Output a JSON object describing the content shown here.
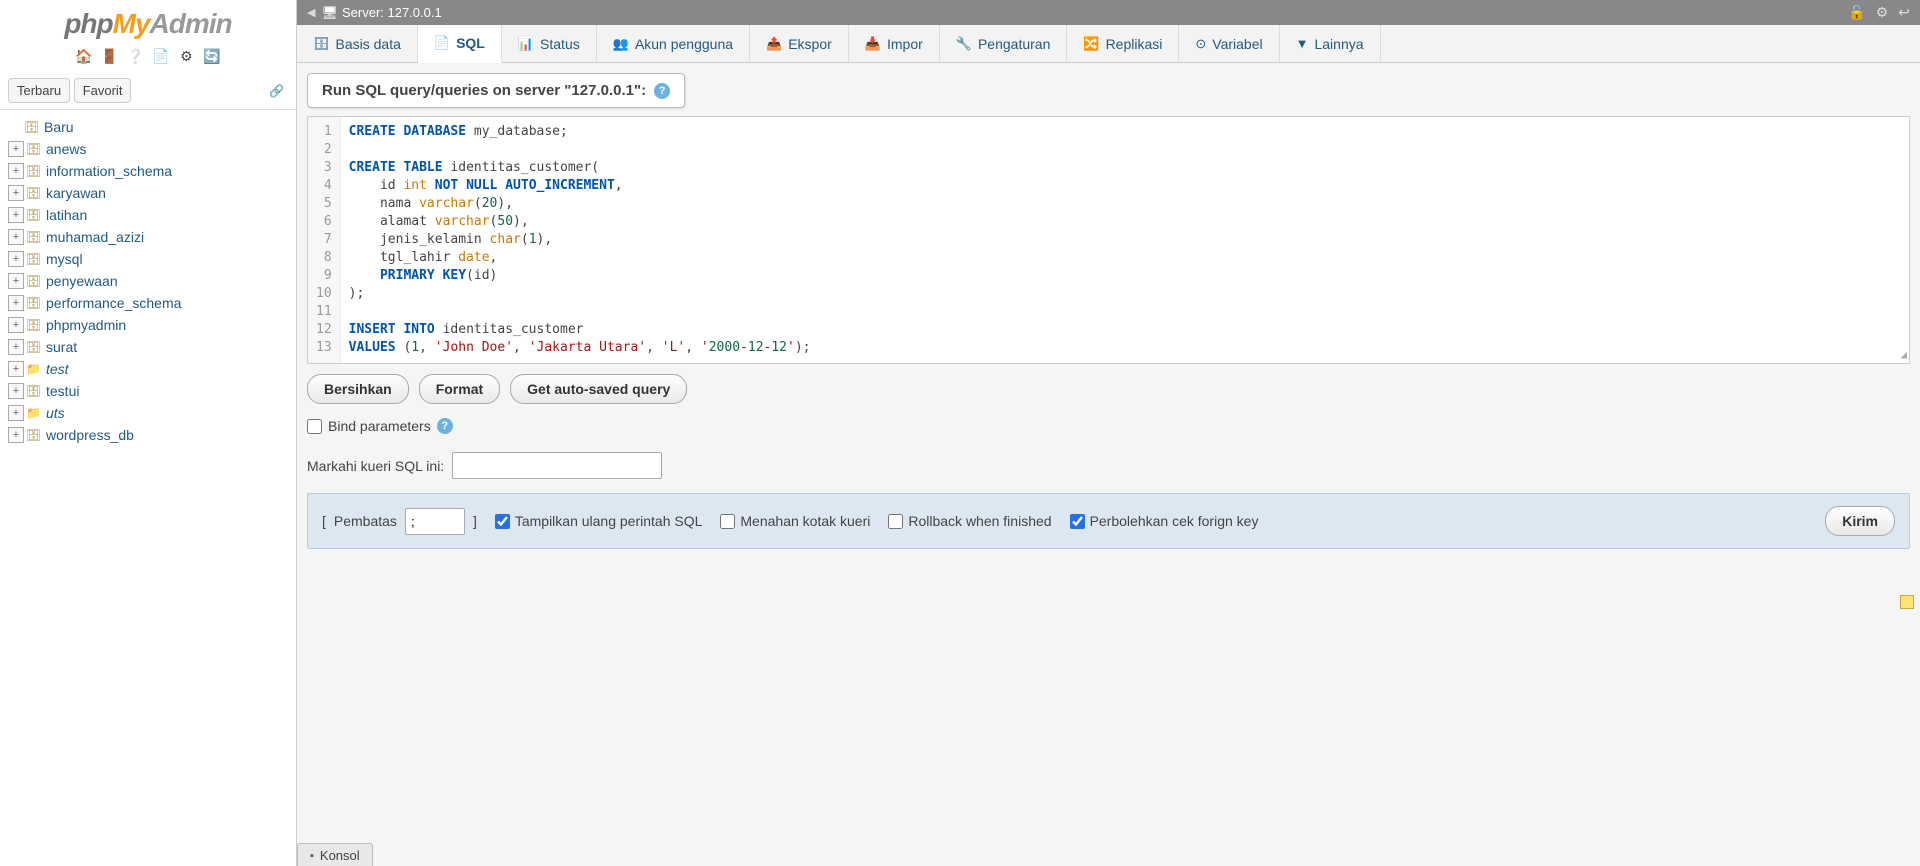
{
  "logo": {
    "p1": "php",
    "p2": "My",
    "p3": "Admin"
  },
  "recent_tabs": {
    "terbaru": "Terbaru",
    "favorit": "Favorit"
  },
  "tree": {
    "baru": "Baru",
    "items": [
      {
        "label": "anews",
        "italic": false,
        "folder": false
      },
      {
        "label": "information_schema",
        "italic": false,
        "folder": false
      },
      {
        "label": "karyawan",
        "italic": false,
        "folder": false
      },
      {
        "label": "latihan",
        "italic": false,
        "folder": false
      },
      {
        "label": "muhamad_azizi",
        "italic": false,
        "folder": false
      },
      {
        "label": "mysql",
        "italic": false,
        "folder": false
      },
      {
        "label": "penyewaan",
        "italic": false,
        "folder": false
      },
      {
        "label": "performance_schema",
        "italic": false,
        "folder": false
      },
      {
        "label": "phpmyadmin",
        "italic": false,
        "folder": false
      },
      {
        "label": "surat",
        "italic": false,
        "folder": false
      },
      {
        "label": "test",
        "italic": true,
        "folder": true
      },
      {
        "label": "testui",
        "italic": false,
        "folder": false
      },
      {
        "label": "uts",
        "italic": true,
        "folder": true
      },
      {
        "label": "wordpress_db",
        "italic": false,
        "folder": false
      }
    ]
  },
  "server_bar": {
    "label": "Server: 127.0.0.1"
  },
  "topnav": [
    {
      "label": "Basis data",
      "icon": "🗄",
      "active": false
    },
    {
      "label": "SQL",
      "icon": "📄",
      "active": true
    },
    {
      "label": "Status",
      "icon": "📊",
      "active": false
    },
    {
      "label": "Akun pengguna",
      "icon": "👥",
      "active": false
    },
    {
      "label": "Ekspor",
      "icon": "📤",
      "active": false
    },
    {
      "label": "Impor",
      "icon": "📥",
      "active": false
    },
    {
      "label": "Pengaturan",
      "icon": "🔧",
      "active": false
    },
    {
      "label": "Replikasi",
      "icon": "🔀",
      "active": false
    },
    {
      "label": "Variabel",
      "icon": "⊙",
      "active": false
    },
    {
      "label": "Lainnya",
      "icon": "▼",
      "active": false
    }
  ],
  "panel": {
    "title": "Run SQL query/queries on server \"127.0.0.1\":"
  },
  "sql_lines": [
    "CREATE DATABASE my_database;",
    "",
    "CREATE TABLE identitas_customer(",
    "    id int NOT NULL AUTO_INCREMENT,",
    "    nama varchar(20),",
    "    alamat varchar(50),",
    "    jenis_kelamin char(1),",
    "    tgl_lahir date,",
    "    PRIMARY KEY(id)",
    ");",
    "",
    "INSERT INTO identitas_customer",
    "VALUES (1, 'John Doe', 'Jakarta Utara', 'L', '2000-12-12');"
  ],
  "buttons": {
    "bersihkan": "Bersihkan",
    "format": "Format",
    "autosaved": "Get auto-saved query"
  },
  "bind_params": "Bind parameters",
  "markahi": {
    "label": "Markahi kueri SQL ini:",
    "value": ""
  },
  "options": {
    "pembatas_label": "Pembatas",
    "pembatas_value": ";",
    "tampilkan": "Tampilkan ulang perintah SQL",
    "menahan": "Menahan kotak kueri",
    "rollback": "Rollback when finished",
    "perbolehkan": "Perbolehkan cek forign key",
    "kirim": "Kirim"
  },
  "konsol": "Konsol"
}
